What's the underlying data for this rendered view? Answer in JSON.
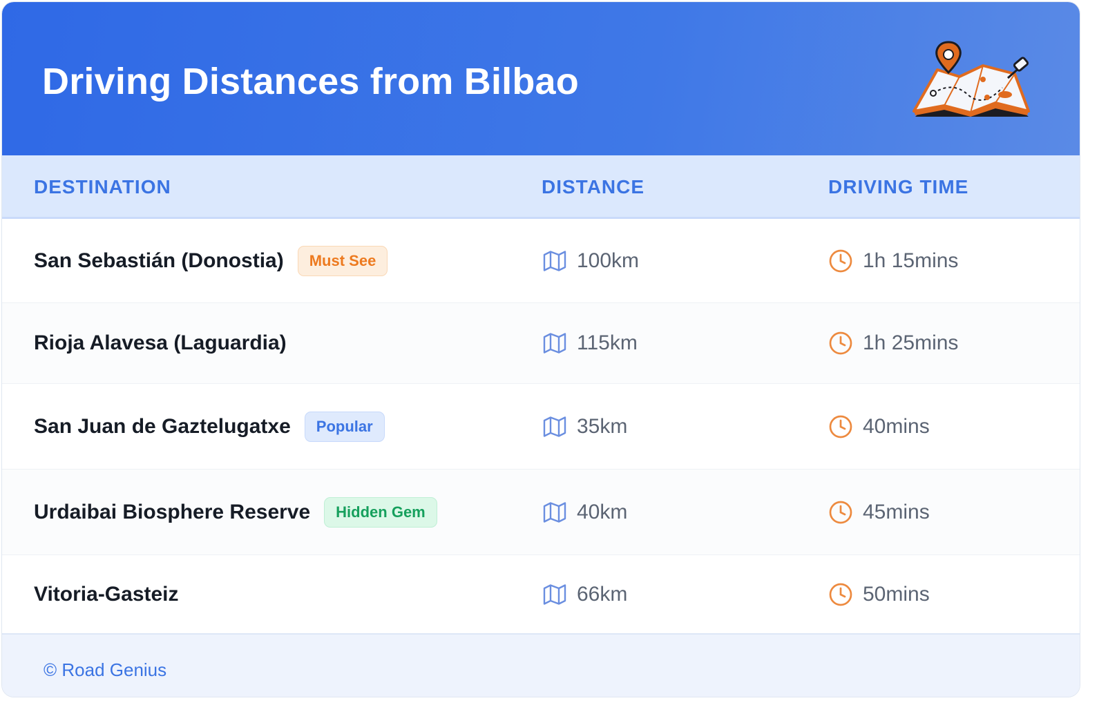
{
  "header": {
    "title": "Driving Distances from Bilbao",
    "icon": "map-pin-icon"
  },
  "table": {
    "columns": [
      "DESTINATION",
      "DISTANCE",
      "DRIVING TIME"
    ],
    "rows": [
      {
        "destination": "San Sebastián (Donostia)",
        "badge": "Must See",
        "badge_color": "#ed7a1f",
        "distance": "100km",
        "time": "1h 15mins"
      },
      {
        "destination": "Rioja Alavesa (Laguardia)",
        "badge": "",
        "badge_color": "",
        "distance": "115km",
        "time": "1h 25mins"
      },
      {
        "destination": "San Juan de Gaztelugatxe",
        "badge": "Popular",
        "badge_color": "#3b74e3",
        "distance": "35km",
        "time": "40mins"
      },
      {
        "destination": "Urdaibai Biosphere Reserve",
        "badge": "Hidden Gem",
        "badge_color": "#16a05d",
        "distance": "40km",
        "time": "45mins"
      },
      {
        "destination": "Vitoria-Gasteiz",
        "badge": "",
        "badge_color": "",
        "distance": "66km",
        "time": "50mins"
      }
    ],
    "distance_icon": "map-icon",
    "time_icon": "clock-icon"
  },
  "footer": {
    "text": "© Road Genius"
  },
  "colors": {
    "accent": "#3b74e3",
    "header_gradient_start": "#2f69e6",
    "time_icon": "#ed8a3f",
    "distance_icon": "#6a8ee0"
  }
}
